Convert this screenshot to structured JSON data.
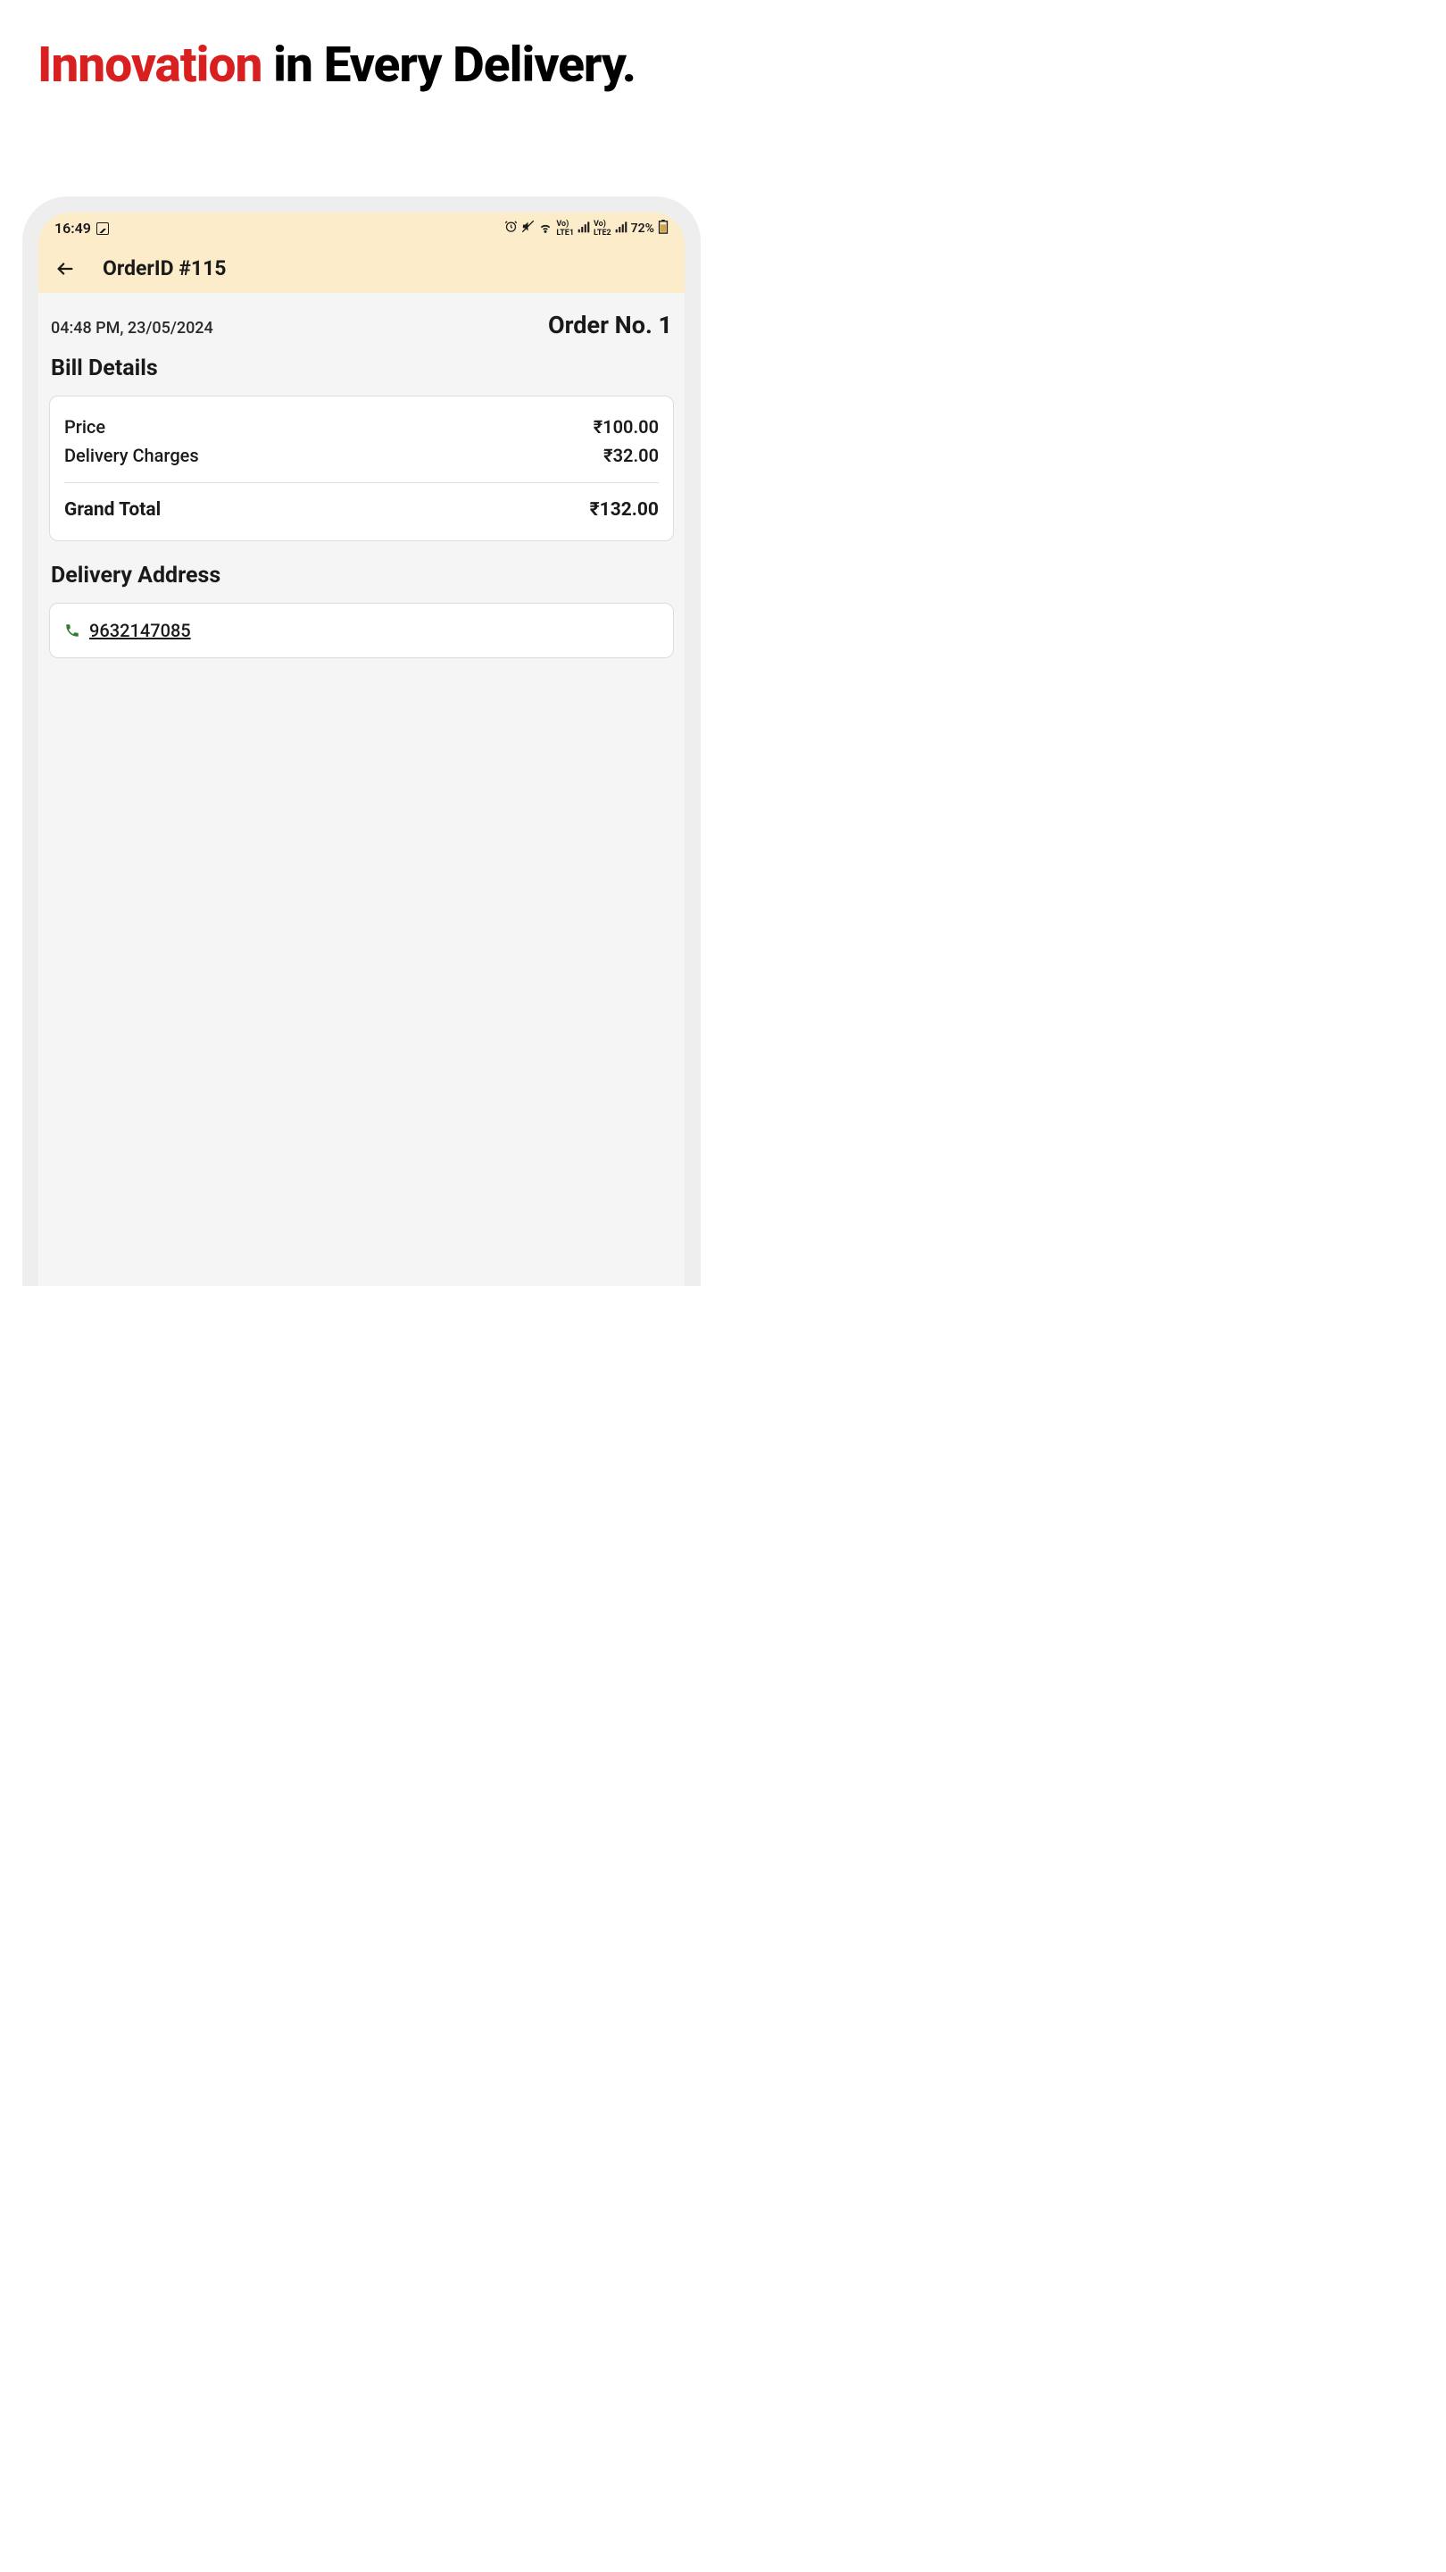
{
  "headline": {
    "accent": "Innovation",
    "rest": " in Every Delivery."
  },
  "status_bar": {
    "time": "16:49",
    "battery": "72%"
  },
  "header": {
    "title": "OrderID #115"
  },
  "meta": {
    "timestamp": "04:48 PM, 23/05/2024",
    "order_number": "Order No. 1"
  },
  "bill": {
    "section_title": "Bill Details",
    "rows": [
      {
        "label": "Price",
        "value": "₹100.00"
      },
      {
        "label": "Delivery Charges",
        "value": "₹32.00"
      }
    ],
    "total": {
      "label": "Grand Total",
      "value": "₹132.00"
    }
  },
  "delivery": {
    "section_title": "Delivery Address",
    "phone": "9632147085"
  }
}
